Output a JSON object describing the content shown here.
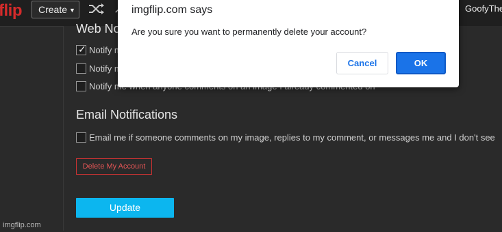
{
  "header": {
    "logo": "flip",
    "create_label": "Create",
    "username": "GoofyThe"
  },
  "settings": {
    "web_section_title": "Web No",
    "web_notifications": [
      {
        "label": "Notify m",
        "checked": true
      },
      {
        "label": "Notify m",
        "checked": false
      },
      {
        "label": "Notify me when anyone comments on an image I already commented on",
        "checked": false
      }
    ],
    "email_section_title": "Email Notifications",
    "email_option": {
      "label": "Email me if someone comments on my image, replies to my comment, or messages me and I don't see",
      "checked": false
    },
    "delete_label": "Delete My Account",
    "update_label": "Update"
  },
  "watermark": "imgflip.com",
  "dialog": {
    "title": "imgflip.com says",
    "message": "Are you sure you want to permanently delete your account?",
    "cancel_label": "Cancel",
    "ok_label": "OK"
  },
  "colors": {
    "logo": "#d52b2b",
    "update_button": "#0cb6ef",
    "delete_border": "#cc3333",
    "dialog_ok": "#1a73e8"
  }
}
